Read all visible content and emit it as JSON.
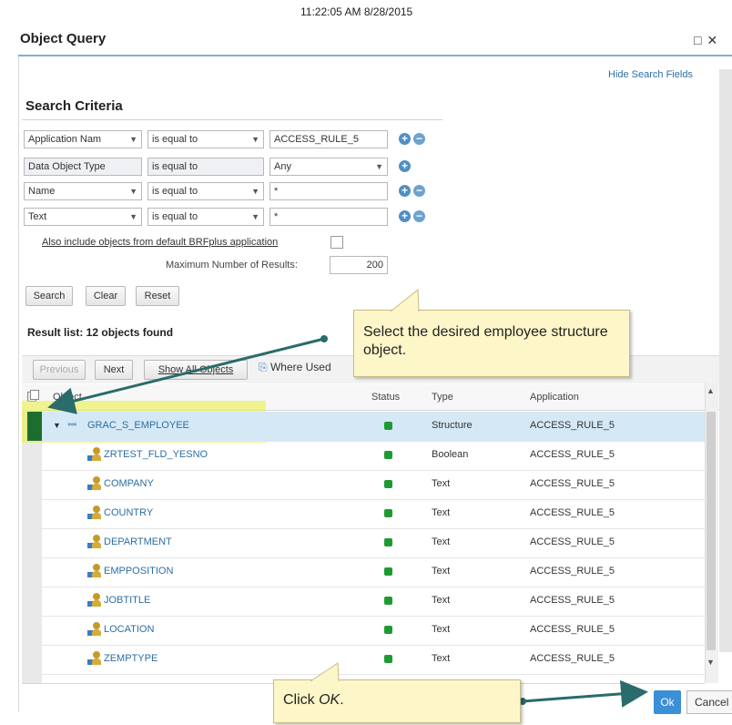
{
  "timestamp": "11:22:05 AM 8/28/2015",
  "window": {
    "title": "Object Query",
    "maximize_icon": "□",
    "close_icon": "✕"
  },
  "hide_search_label": "Hide Search Fields",
  "search": {
    "title": "Search Criteria",
    "rows": [
      {
        "field": "Application Nam",
        "op": "is equal to",
        "value": "ACCESS_RULE_5"
      },
      {
        "field": "Data Object Type",
        "op": "is equal to",
        "value": "Any"
      },
      {
        "field": "Name",
        "op": "is equal to",
        "value": "*"
      },
      {
        "field": "Text",
        "op": "is equal to",
        "value": "*"
      }
    ],
    "include_default_label": "Also include objects from default BRFplus application",
    "max_results_label": "Maximum Number of Results:",
    "max_results_value": "200",
    "buttons": {
      "search": "Search",
      "clear": "Clear",
      "reset": "Reset"
    }
  },
  "results": {
    "title": "Result list: 12  objects found",
    "toolbar": {
      "previous": "Previous",
      "next": "Next",
      "show_all": "Show All Objects",
      "where_used": "Where Used"
    },
    "columns": {
      "object": "Object",
      "status": "Status",
      "type": "Type",
      "application": "Application"
    },
    "rows": [
      {
        "object": "GRAC_S_EMPLOYEE",
        "type": "Structure",
        "application": "ACCESS_RULE_5"
      },
      {
        "object": "ZRTEST_FLD_YESNO",
        "type": "Boolean",
        "application": "ACCESS_RULE_5"
      },
      {
        "object": "COMPANY",
        "type": "Text",
        "application": "ACCESS_RULE_5"
      },
      {
        "object": "COUNTRY",
        "type": "Text",
        "application": "ACCESS_RULE_5"
      },
      {
        "object": "DEPARTMENT",
        "type": "Text",
        "application": "ACCESS_RULE_5"
      },
      {
        "object": "EMPPOSITION",
        "type": "Text",
        "application": "ACCESS_RULE_5"
      },
      {
        "object": "JOBTITLE",
        "type": "Text",
        "application": "ACCESS_RULE_5"
      },
      {
        "object": "LOCATION",
        "type": "Text",
        "application": "ACCESS_RULE_5"
      },
      {
        "object": "ZEMPTYPE",
        "type": "Text",
        "application": "ACCESS_RULE_5"
      }
    ]
  },
  "callouts": {
    "select": "Select the desired employee structure object.",
    "click_ok_prefix": "Click ",
    "click_ok_em": "OK",
    "click_ok_suffix": "."
  },
  "footer": {
    "ok": "Ok",
    "cancel": "Cancel"
  },
  "colors": {
    "accent": "#3a8fd6",
    "status_green": "#1e9a32",
    "highlight": "#e8f03c",
    "arrow": "#2a6b6b"
  }
}
